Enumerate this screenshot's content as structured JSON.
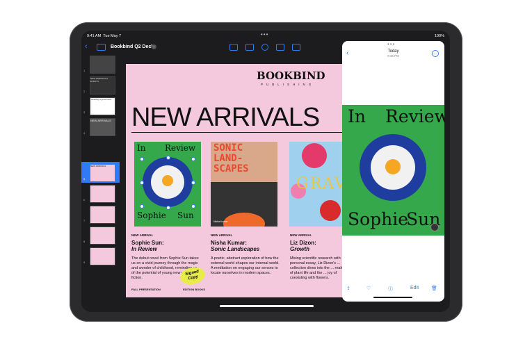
{
  "status": {
    "time": "9:41 AM",
    "date": "Tue May 7",
    "battery": "100%",
    "dots": "•••"
  },
  "toolbar": {
    "back_glyph": "‹",
    "title": "Bookbind Q2 Deck",
    "chevron": "⌄"
  },
  "navigator": {
    "slide_numbers": [
      "1",
      "2",
      "3",
      "4",
      "5",
      "6",
      "7",
      "8",
      "9"
    ],
    "thumb_texts": [
      "",
      "NEW ARRIVALS & EVENTS",
      "\"Reading a good book...\"",
      "NEW ARRIVALS",
      "NEW ARRIVALS"
    ]
  },
  "slide": {
    "logo": "BOOKBIND",
    "logo_sub": "PUBLISHING",
    "headline": "NEW ARRIVALS",
    "books": [
      {
        "cover_top_left": "In",
        "cover_top_right": "Review",
        "cover_bottom_left": "Sophie",
        "cover_bottom_right": "Sun"
      },
      {
        "cover_title": "SONIC\nLAND-\nSCAPES",
        "cover_author": "Nisha Kumar"
      },
      {
        "cover_title": "GRAVITY"
      }
    ],
    "columns": [
      {
        "tag": "NEW ARRIVAL",
        "author": "Sophie Sun:",
        "book": "In Review",
        "desc": "The debut novel from Sophie Sun takes us on a vivid journey through the magic and wonder of childhood, reminding us of the potential of young new voices in fiction."
      },
      {
        "tag": "NEW ARRIVAL",
        "author": "Nisha Kumar:",
        "book": "Sonic Landscapes",
        "desc": "A poetic, abstract exploration of how the external world shapes our internal world. A meditation on engaging our senses to locate ourselves in modern spaces."
      },
      {
        "tag": "NEW ARRIVAL",
        "author": "Liz Dizon:",
        "book": "Growth",
        "desc": "Mixing scientific research with personal essay, Liz Dizon's ... collection dives into the ... realm of plant life and the ... joy of coexisting with flowers."
      }
    ],
    "signed_copy": "Signed Copy",
    "footer_left": "FALL PRESENTATION",
    "footer_mid": "EDITION BOOKS"
  },
  "photos": {
    "dots": "•••",
    "back_glyph": "‹",
    "date": "Today",
    "time": "9:35 PM",
    "more_glyph": "…",
    "image_top_left": "In",
    "image_top_right": "Review",
    "image_bottom_left": "Sophie",
    "image_bottom_right": "Sun",
    "share_glyph": "⇪",
    "favorite_glyph": "♡",
    "info_glyph": "ⓘ",
    "edit_label": "Edit",
    "delete_glyph": "🗑"
  },
  "colors": {
    "accent": "#2f7bf5",
    "slide_bg": "#f4c9dd",
    "cover_green": "#34a84a",
    "plate_blue": "#1f3d9e",
    "signed_yellow": "#e7ec4a"
  }
}
